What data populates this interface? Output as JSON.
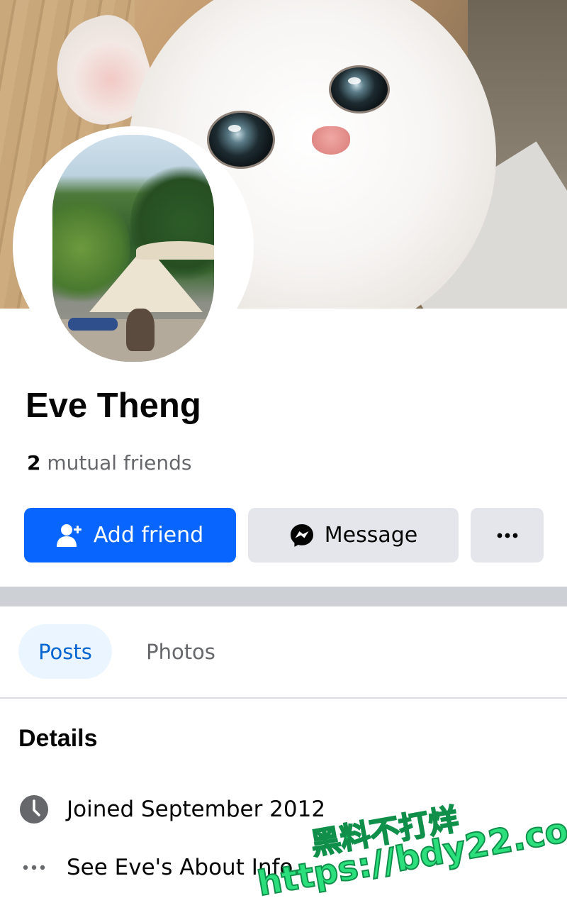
{
  "profile": {
    "name": "Eve Theng",
    "mutual_count": "2",
    "mutual_label": "mutual friends"
  },
  "actions": {
    "add_friend_label": "Add friend",
    "add_friend_icon": "add-person-icon",
    "message_label": "Message",
    "message_icon": "messenger-icon",
    "more_label": "•••",
    "primary_color": "#0866ff",
    "secondary_color": "#e4e6eb"
  },
  "tabs": [
    {
      "label": "Posts",
      "active": true
    },
    {
      "label": "Photos",
      "active": false
    }
  ],
  "details": {
    "title": "Details",
    "items": [
      {
        "icon": "clock-icon",
        "text": "Joined September 2012"
      },
      {
        "icon": "more-dots-icon",
        "text": "See Eve's About Info"
      }
    ]
  },
  "watermark": {
    "line1": "黑料不打烊",
    "line2": "https://bdy22.co"
  }
}
